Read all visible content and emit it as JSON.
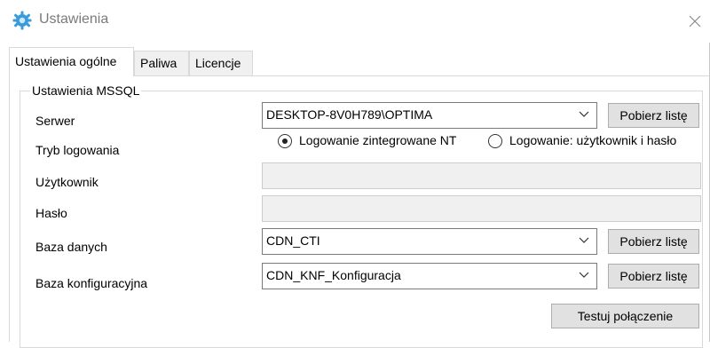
{
  "window": {
    "title": "Ustawienia",
    "icon": "gear-icon",
    "close_icon": "close-icon"
  },
  "tabs": [
    {
      "label": "Ustawienia ogólne",
      "active": true
    },
    {
      "label": "Paliwa",
      "active": false
    },
    {
      "label": "Licencje",
      "active": false
    }
  ],
  "group": {
    "title": "Ustawienia MSSQL"
  },
  "labels": {
    "server": "Serwer",
    "login_mode": "Tryb logowania",
    "user": "Użytkownik",
    "password": "Hasło",
    "database": "Baza danych",
    "config_database": "Baza konfiguracyjna"
  },
  "fields": {
    "server": "DESKTOP-8V0H789\\OPTIMA",
    "user": "",
    "password": "",
    "database": "CDN_CTI",
    "config_database": "CDN_KNF_Konfiguracja"
  },
  "login_options": [
    {
      "label": "Logowanie zintegrowane NT",
      "selected": true
    },
    {
      "label": "Logowanie: użytkownik i hasło",
      "selected": false
    }
  ],
  "buttons": {
    "fetch_list": "Pobierz listę",
    "test_connection": "Testuj połączenie"
  },
  "colors": {
    "icon_accent": "#3a9bdc",
    "button_bg": "#e1e1e1",
    "disabled_field": "#f0f0f0"
  }
}
